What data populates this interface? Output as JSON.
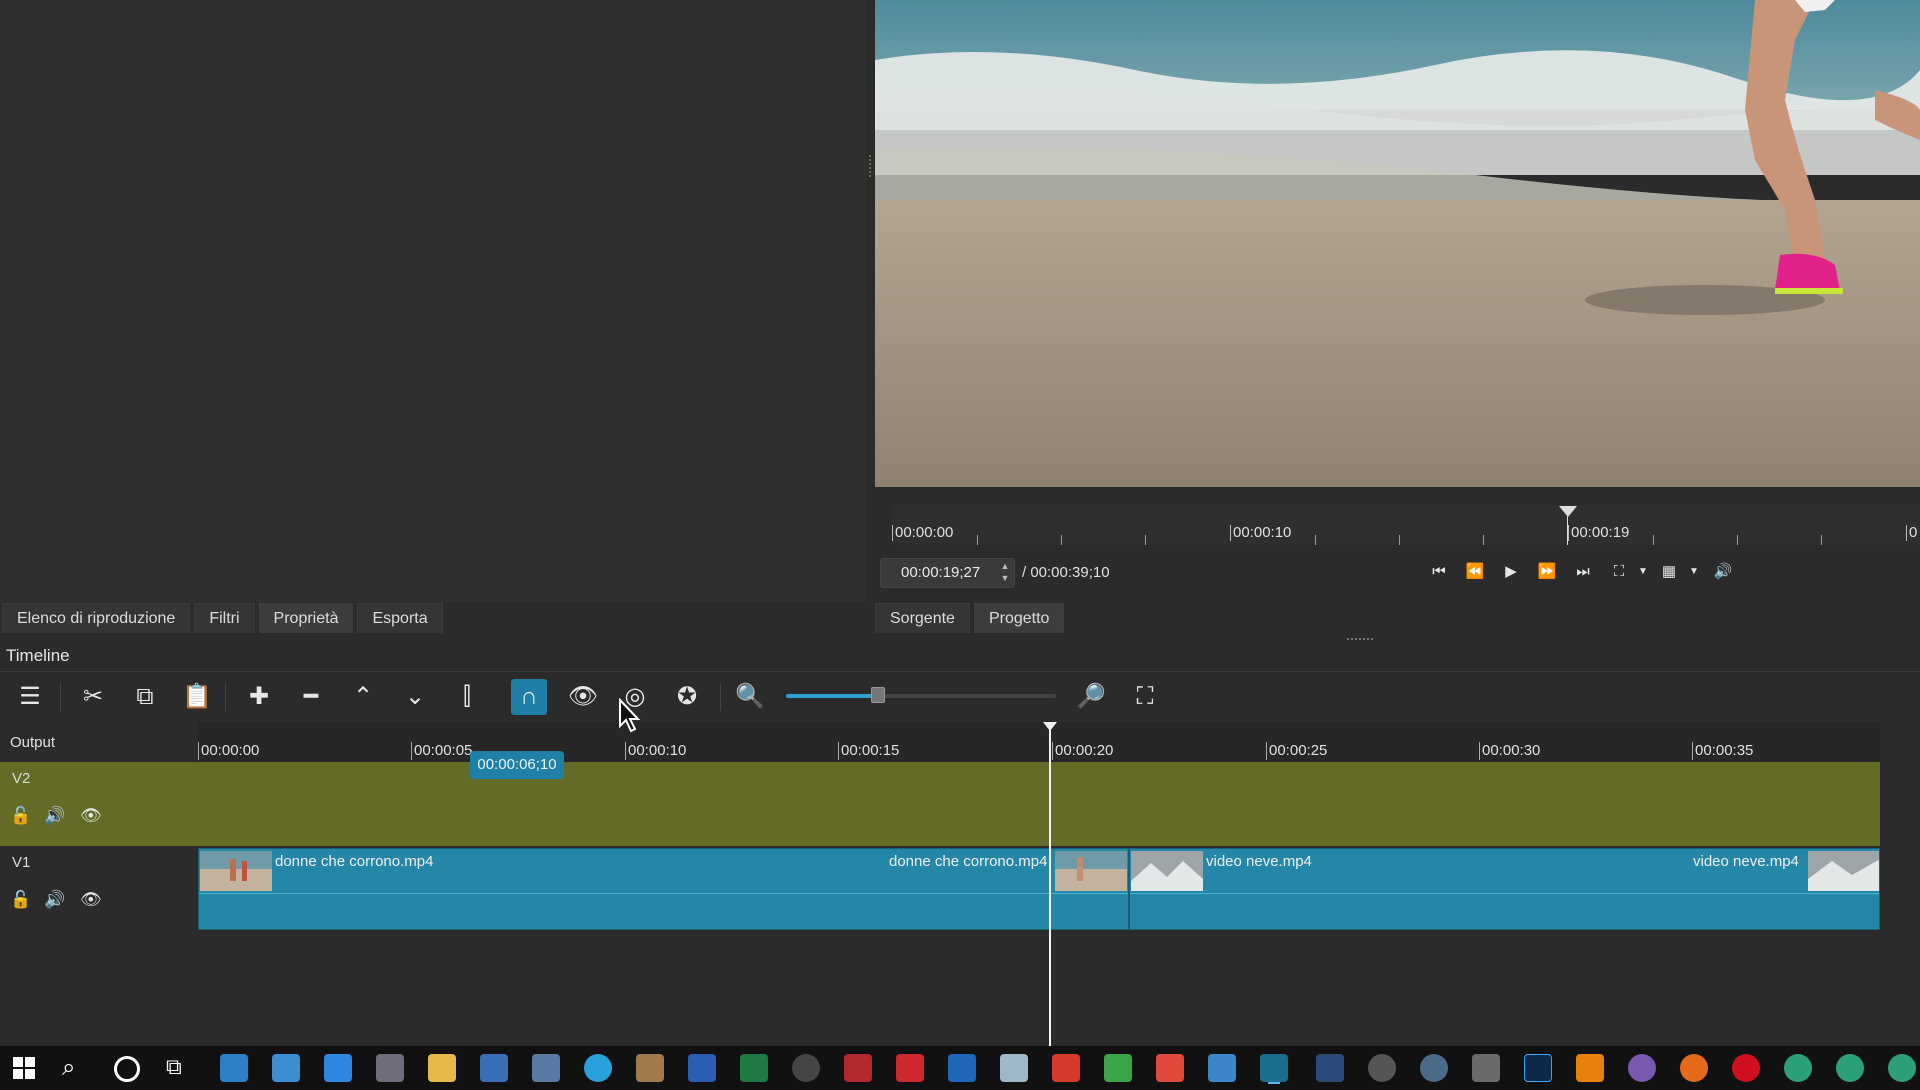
{
  "left_tabs": [
    "Elenco di riproduzione",
    "Filtri",
    "Proprietà",
    "Esporta"
  ],
  "player": {
    "ruler_labels": [
      "00:00:00",
      "00:00:10",
      "00:00:19",
      "0"
    ],
    "timecode": "00:00:19;27",
    "total": "/ 00:00:39;10",
    "source_tabs": [
      "Sorgente",
      "Progetto"
    ]
  },
  "timeline": {
    "title": "Timeline",
    "output_label": "Output",
    "ruler_labels": [
      "00:00:00",
      "00:00:05",
      "00:00:10",
      "00:00:15",
      "00:00:20",
      "00:00:25",
      "00:00:30",
      "00:00:35"
    ],
    "hover_timecode": "00:00:06;10",
    "tracks": [
      {
        "name": "V2"
      },
      {
        "name": "V1"
      }
    ],
    "clips": [
      {
        "label_start": "donne che corrono.mp4",
        "label_end": "donne che corrono.mp4"
      },
      {
        "label_start": "video neve.mp4",
        "label_end": "video neve.mp4"
      }
    ],
    "zoom_level": 0.33
  },
  "icons": {
    "toolbar": [
      "menu-icon",
      "cut-icon",
      "copy-icon",
      "paste-icon",
      "append-icon",
      "remove-icon",
      "lift-icon",
      "overwrite-icon",
      "split-icon",
      "snap-icon",
      "scrub-icon",
      "ripple-icon",
      "ripple-all-icon",
      "zoom-out-icon",
      "zoom-in-icon",
      "zoom-fit-icon"
    ],
    "player": [
      "skip-start-icon",
      "rewind-icon",
      "play-icon",
      "fast-forward-icon",
      "skip-end-icon",
      "zoom-icon",
      "grid-icon",
      "volume-icon"
    ]
  },
  "colors": {
    "accent": "#1f7fa6",
    "clip": "#2487a8",
    "v2_track": "#636b26"
  }
}
